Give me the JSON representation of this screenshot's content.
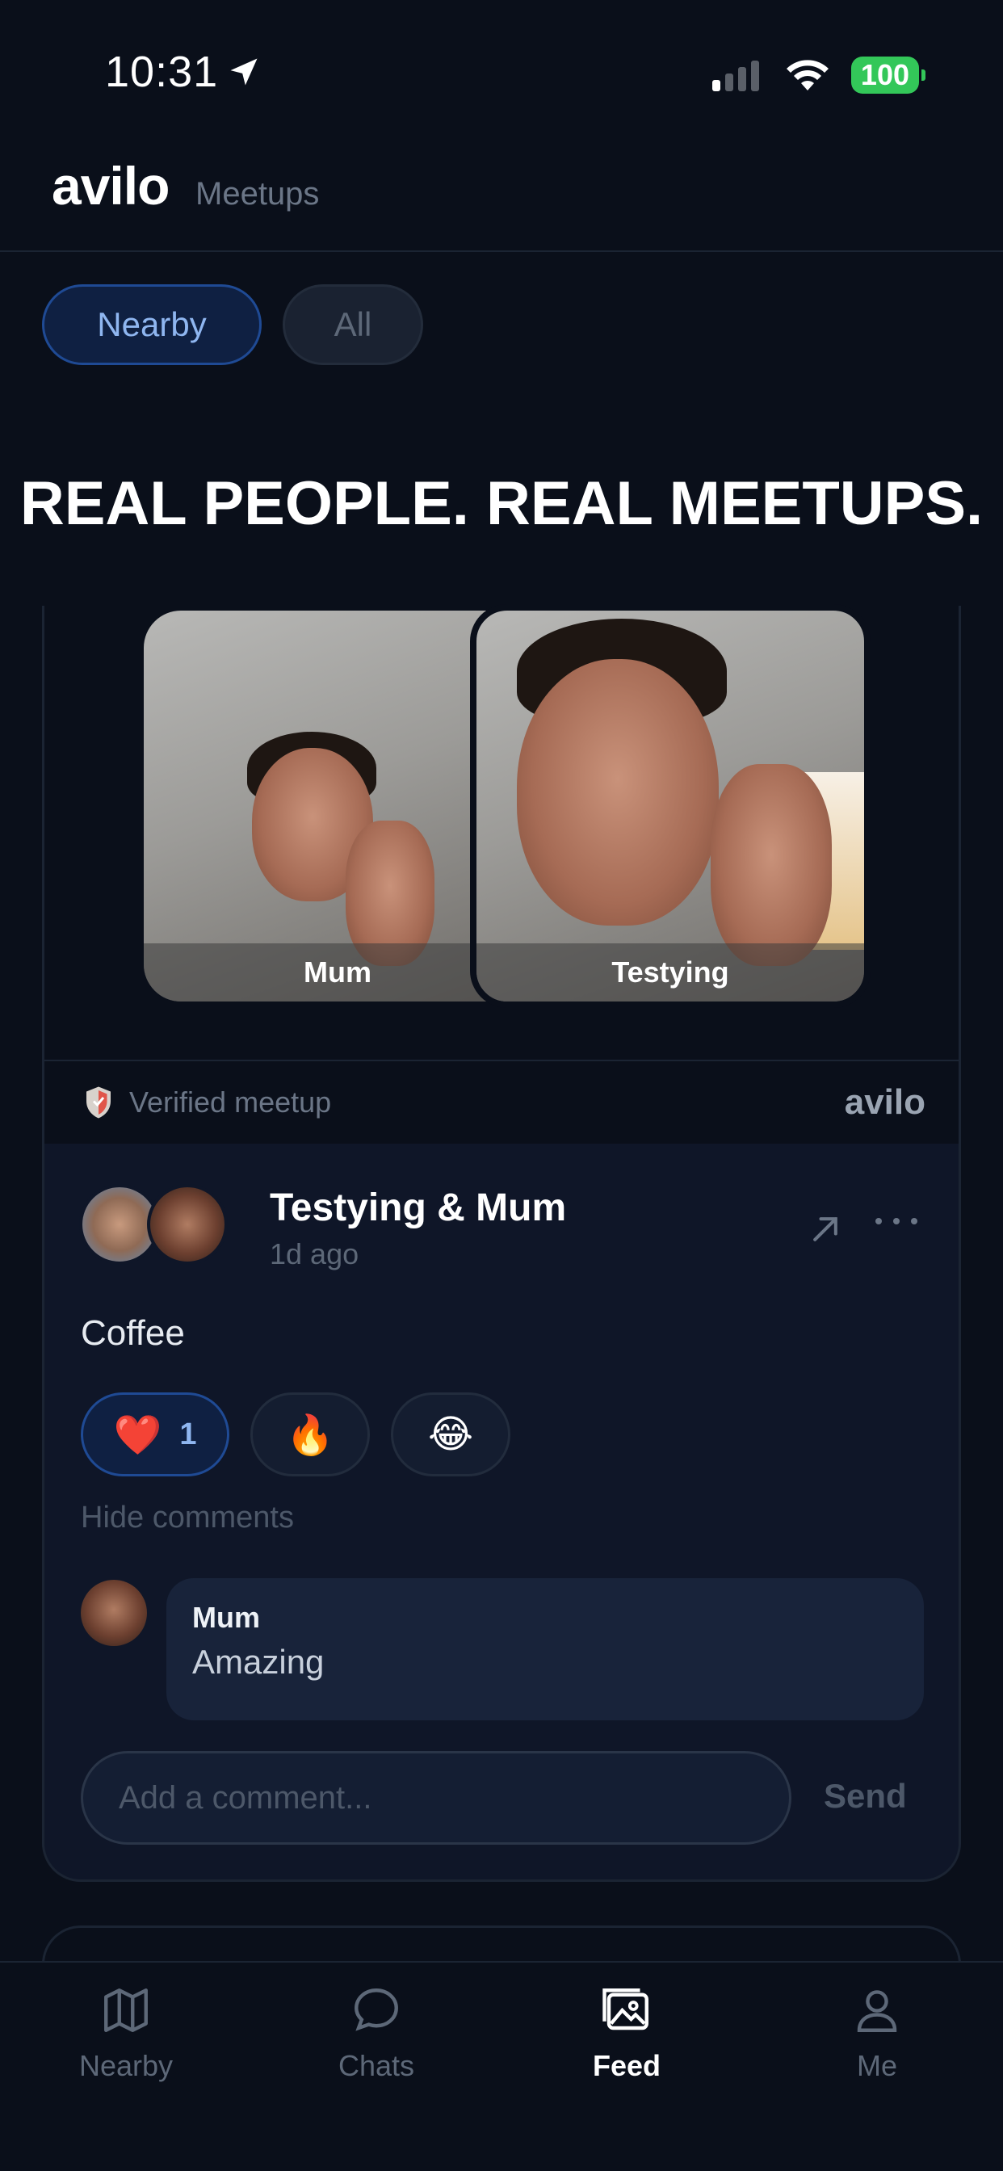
{
  "status_bar": {
    "time": "10:31",
    "battery": "100"
  },
  "header": {
    "brand": "avilo",
    "subtitle": "Meetups"
  },
  "filters": [
    {
      "label": "Nearby",
      "active": true
    },
    {
      "label": "All",
      "active": false
    }
  ],
  "headline": "REAL PEOPLE. REAL MEETUPS.",
  "meetup": {
    "photos": [
      {
        "label": "Mum"
      },
      {
        "label": "Testying"
      }
    ],
    "verified_label": "Verified meetup",
    "verified_brand": "avilo",
    "title": "Testying & Mum",
    "time_ago": "1d ago",
    "body": "Coffee",
    "reactions": [
      {
        "emoji": "❤️",
        "count": "1",
        "active": true
      },
      {
        "emoji": "🔥"
      },
      {
        "emoji": "😂"
      }
    ],
    "hide_comments": "Hide comments",
    "comments": [
      {
        "author": "Mum",
        "text": "Amazing"
      }
    ],
    "comment_placeholder": "Add a comment...",
    "send_label": "Send"
  },
  "tabbar": [
    {
      "label": "Nearby",
      "icon": "map-icon"
    },
    {
      "label": "Chats",
      "icon": "chat-bubble-icon"
    },
    {
      "label": "Feed",
      "icon": "photos-icon",
      "active": true
    },
    {
      "label": "Me",
      "icon": "person-icon"
    }
  ],
  "colors": {
    "accent": "#8fb6f0",
    "background": "#0a0f1a",
    "battery": "#33c759"
  }
}
